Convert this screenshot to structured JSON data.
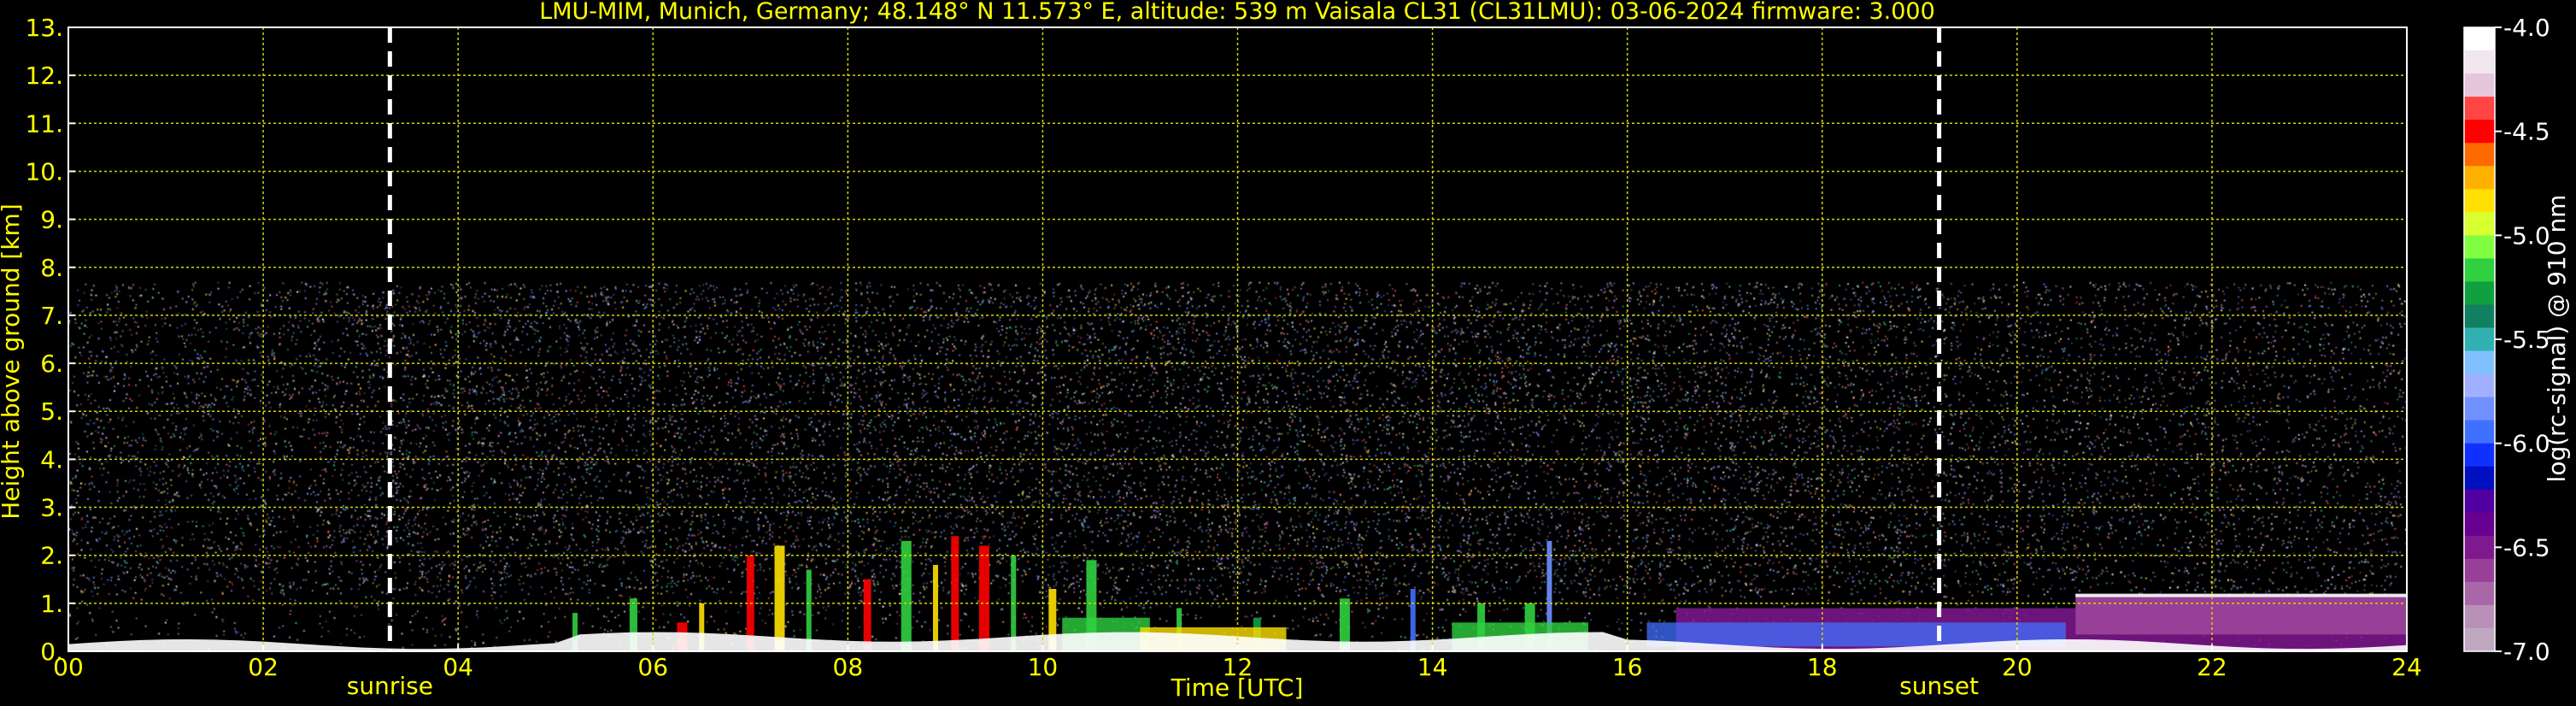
{
  "chart_data": {
    "type": "heatmap",
    "title": "LMU-MIM, Munich, Germany; 48.148° N 11.573° E, altitude: 539 m    Vaisala CL31 (CL31LMU): 03-06-2024    firmware: 3.000",
    "xlabel": "Time [UTC]",
    "ylabel": "Height above ground [km]",
    "xlim": [
      0,
      24
    ],
    "ylim": [
      0,
      13
    ],
    "x_ticks": [
      0,
      2,
      4,
      6,
      8,
      10,
      12,
      14,
      16,
      18,
      20,
      22,
      24
    ],
    "x_tick_labels": [
      "00",
      "02",
      "04",
      "06",
      "08",
      "10",
      "12",
      "14",
      "16",
      "18",
      "20",
      "22",
      "24"
    ],
    "y_ticks": [
      0,
      1,
      2,
      3,
      4,
      5,
      6,
      7,
      8,
      9,
      10,
      11,
      12,
      13
    ],
    "y_tick_labels": [
      "0.",
      "1.",
      "2.",
      "3.",
      "4.",
      "5.",
      "6.",
      "7.",
      "8.",
      "9.",
      "10.",
      "11.",
      "12.",
      "13."
    ],
    "grid": true,
    "signal_top_km": 7.7,
    "markers": [
      {
        "label": "sunrise",
        "time": 3.3
      },
      {
        "label": "sunset",
        "time": 19.2
      }
    ],
    "colorbar": {
      "label": "log(rc-signal) @ 910 nm",
      "range": [
        -7.0,
        -4.0
      ],
      "ticks": [
        -4.0,
        -4.5,
        -5.0,
        -5.5,
        -6.0,
        -6.5,
        -7.0
      ],
      "tick_labels": [
        "-4.0",
        "-4.5",
        "-5.0",
        "-5.5",
        "-6.0",
        "-6.5",
        "-7.0"
      ],
      "colors": [
        "#ffffff",
        "#f2e6f0",
        "#e6c6dc",
        "#ff4444",
        "#ff0000",
        "#ff6a00",
        "#ffb000",
        "#ffe000",
        "#d8ff30",
        "#80ff40",
        "#30d040",
        "#10a040",
        "#108060",
        "#30b0b0",
        "#80c0ff",
        "#a0b0ff",
        "#7090ff",
        "#4070ff",
        "#1030ff",
        "#0010c0",
        "#5000a0",
        "#680090",
        "#801890",
        "#984098",
        "#a868a8",
        "#b890b8",
        "#c0a8c0"
      ]
    },
    "layers": [
      {
        "name": "noise",
        "from_time": 0,
        "to_time": 24,
        "from_km": 1.2,
        "to_km": 7.7
      },
      {
        "name": "boundary-layer-aerosol",
        "from_time": 0,
        "to_time": 24,
        "from_km": 0,
        "to_km": 0.4
      },
      {
        "name": "convective-plumes",
        "from_time": 5.5,
        "to_time": 15.3,
        "from_km": 0,
        "to_km": 2.4
      },
      {
        "name": "evening-residual-layer",
        "from_time": 16.5,
        "to_time": 24,
        "from_km": 0,
        "to_km": 1.2
      }
    ]
  }
}
